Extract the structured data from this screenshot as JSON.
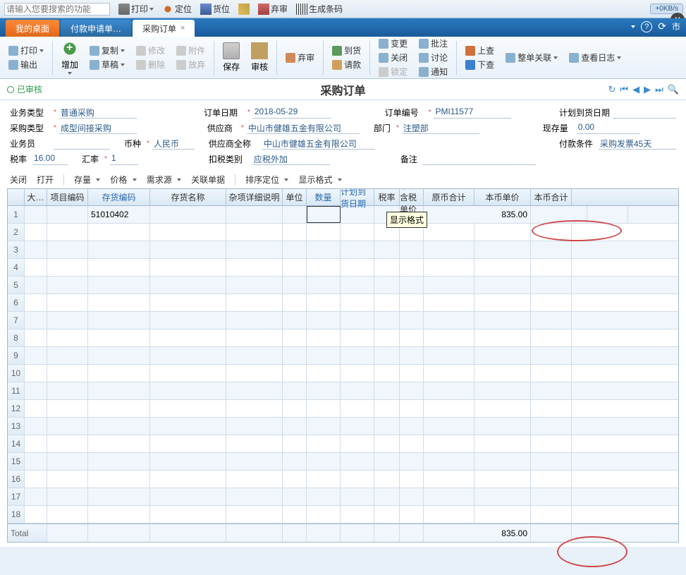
{
  "top": {
    "search_placeholder": "请输入您要搜索的功能",
    "btn_print": "打印",
    "btn_locate": "定位",
    "btn_stock": "货位",
    "btn_reject": "弃审",
    "btn_barcode": "生成条码",
    "net_speed": "+0KB/s"
  },
  "tabs": {
    "t0": "我的桌面",
    "t1": "付款申请单…",
    "t2": "采购订单"
  },
  "ribbon": {
    "print": "打印",
    "output": "输出",
    "add": "增加",
    "copy": "复制",
    "modify": "修改",
    "attach": "附件",
    "draft": "草稿",
    "delete": "删除",
    "giveup": "放弃",
    "save": "保存",
    "audit": "审核",
    "reject": "弃审",
    "arrive": "到货",
    "request": "请款",
    "change": "变更",
    "close": "关闭",
    "lock": "锁定",
    "approve": "批注",
    "discuss": "讨论",
    "notify": "通知",
    "up": "上查",
    "down": "下查",
    "relate": "整单关联",
    "log": "查看日志"
  },
  "title": {
    "approved": "已审核",
    "page_title": "采购订单"
  },
  "form": {
    "biz_type_lbl": "业务类型",
    "biz_type": "普通采购",
    "order_date_lbl": "订单日期",
    "order_date": "2018-05-29",
    "order_no_lbl": "订单编号",
    "order_no": "PMI11577",
    "plan_date_lbl": "计划到货日期",
    "purchase_type_lbl": "采购类型",
    "purchase_type": "成型间接采购",
    "supplier_lbl": "供应商",
    "supplier": "中山市健雄五金有限公司",
    "dept_lbl": "部门",
    "dept": "注塑部",
    "stock_lbl": "现存量",
    "stock": "0.00",
    "clerk_lbl": "业务员",
    "currency_lbl": "币种",
    "currency": "人民币",
    "supplier_full_lbl": "供应商全称",
    "supplier_full": "中山市健雄五金有限公司",
    "pay_term_lbl": "付款条件",
    "pay_term": "采购发票45天",
    "tax_rate_lbl": "税率",
    "tax_rate": "16.00",
    "exch_lbl": "汇率",
    "exch": "1",
    "tax_kind_lbl": "扣税类别",
    "tax_kind": "应税外加",
    "remark_lbl": "备注"
  },
  "gtb": {
    "close": "关闭",
    "open": "打开",
    "stock": "存量",
    "price": "价格",
    "demand": "需求源",
    "relate": "关联单据",
    "sort": "排序定位",
    "display": "显示格式"
  },
  "grid": {
    "h1": "大…",
    "h2": "项目编码",
    "h3": "存货编码",
    "h4": "存货名称",
    "h5": "杂项详细说明",
    "h6": "单位",
    "h7": "数量",
    "h8": "计划到货日期",
    "h9": "税率",
    "h10": "原币含税单价",
    "h11": "原币合计",
    "h12": "本币单价",
    "h13": "本币合计",
    "row1_code": "51010402",
    "row1_total": "835.00",
    "total_label": "Total",
    "total_value": "835.00",
    "tooltip": "显示格式"
  }
}
